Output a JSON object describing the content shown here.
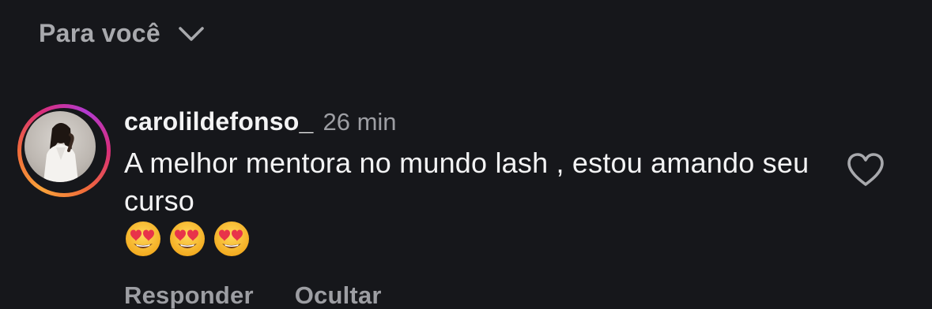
{
  "header": {
    "sort_label": "Para você",
    "sort_icon": "chevron-down-icon"
  },
  "comment": {
    "username": "carolildefonso_",
    "timestamp": "26 min",
    "text": "A melhor mentora no mundo lash , estou amando seu curso",
    "emojis": [
      "😍",
      "😍",
      "😍"
    ],
    "reply_label": "Responder",
    "hide_label": "Ocultar",
    "like_icon": "heart-outline-icon",
    "avatar_ring_colors": [
      "#f9a23a",
      "#d92e7a",
      "#b13ad1"
    ]
  },
  "colors": {
    "background": "#16171b",
    "primary_text": "#f3f3f4",
    "secondary_text": "#9d9ea3"
  }
}
